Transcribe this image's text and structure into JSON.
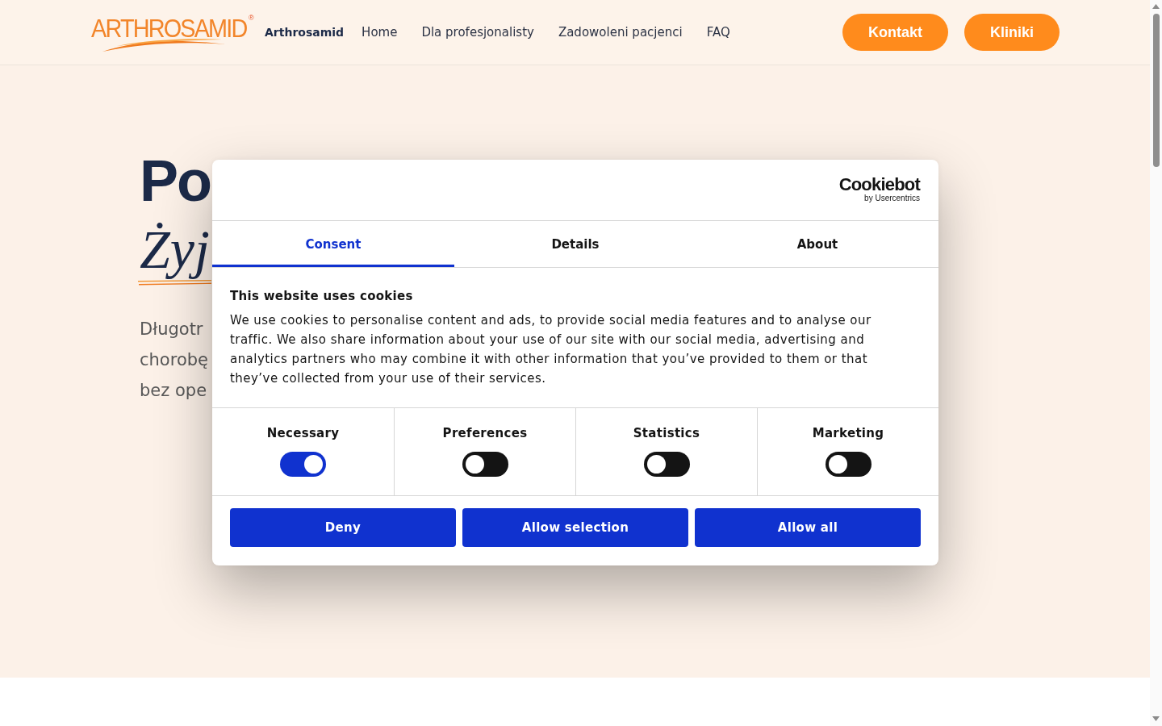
{
  "header": {
    "logo": {
      "wordmark": "ARTHROSAMID",
      "mark": "®"
    },
    "site_name": "Arthrosamid",
    "nav": [
      {
        "label": "Home"
      },
      {
        "label": "Dla profesjonalisty"
      },
      {
        "label": "Zadowoleni pacjenci"
      },
      {
        "label": "FAQ"
      }
    ],
    "buttons": [
      {
        "label": "Kontakt"
      },
      {
        "label": "Kliniki"
      }
    ]
  },
  "hero": {
    "heading": "Po",
    "accent": "Żyj",
    "paragraph_lines": [
      "Długotr",
      "chorobę",
      "bez ope"
    ]
  },
  "cookie_dialog": {
    "brand": {
      "name": "Cookiebot",
      "tagline": "by Usercentrics"
    },
    "tabs": [
      {
        "label": "Consent",
        "selected": true
      },
      {
        "label": "Details",
        "selected": false
      },
      {
        "label": "About",
        "selected": false
      }
    ],
    "title": "This website uses cookies",
    "body": "We use cookies to personalise content and ads, to provide social media features and to analyse our traffic. We also share information about your use of our site with our social media, advertising and analytics partners who may combine it with other information that you’ve provided to them or that they’ve collected from your use of their services.",
    "categories": [
      {
        "label": "Necessary",
        "checked": true
      },
      {
        "label": "Preferences",
        "checked": false
      },
      {
        "label": "Statistics",
        "checked": false
      },
      {
        "label": "Marketing",
        "checked": false
      }
    ],
    "buttons": [
      {
        "label": "Deny"
      },
      {
        "label": "Allow selection"
      },
      {
        "label": "Allow all"
      }
    ]
  }
}
